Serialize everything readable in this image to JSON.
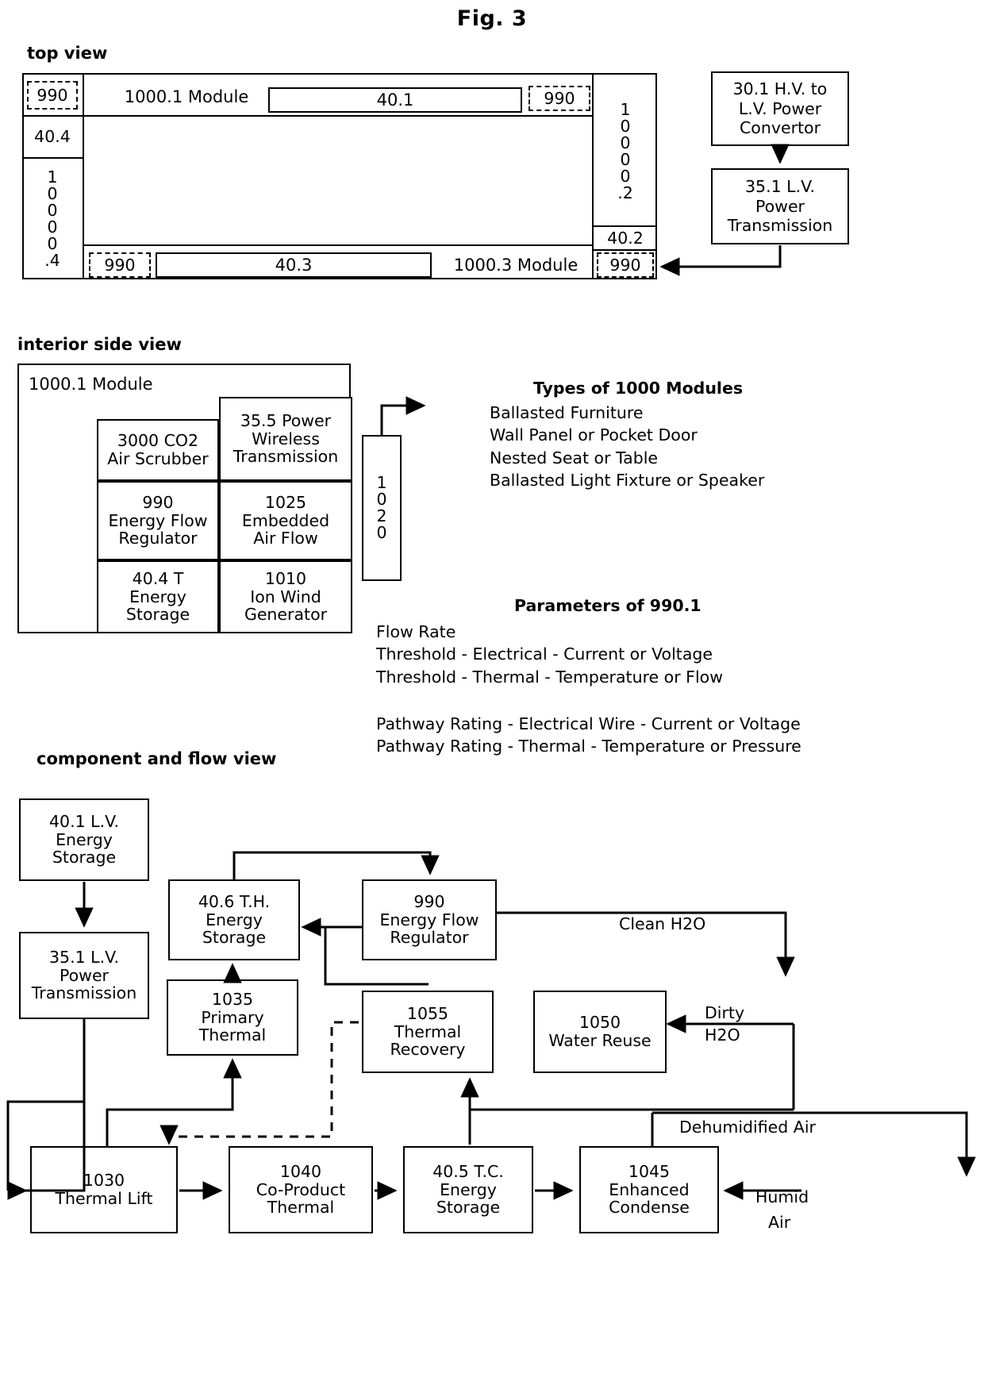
{
  "figure": {
    "title": "Fig. 3"
  },
  "views": {
    "top": {
      "label": "top view",
      "left_column": {
        "regulator_top": "990",
        "storage": "40.4",
        "vertical_id_chars": [
          "1",
          "0",
          "0",
          "0",
          "0",
          ".4"
        ]
      },
      "row_top": {
        "module_label": "1000.1 Module",
        "bus": "40.1",
        "regulator_right": "990"
      },
      "right_column": {
        "vertical_id_chars": [
          "1",
          "0",
          "0",
          "0",
          "0",
          ".2"
        ],
        "storage": "40.2",
        "regulator_bottom": "990"
      },
      "row_bottom": {
        "regulator_left": "990",
        "bus": "40.3",
        "module_label": "1000.3 Module"
      },
      "power_chain": {
        "converter": "30.1 H.V. to L.V. Power Convertor",
        "converter_lines": [
          "30.1 H.V. to",
          "L.V. Power",
          "Convertor"
        ],
        "transmission": "35.1 L.V. Power Transmission",
        "transmission_lines": [
          "35.1 L.V.",
          "Power",
          "Transmission"
        ]
      }
    },
    "interior": {
      "label": "interior side view",
      "module_label": "1000.1 Module",
      "cells": [
        {
          "lines": [
            "3000 CO2",
            "Air Scrubber"
          ]
        },
        {
          "lines": [
            "35.5 Power",
            "Wireless",
            "Transmission"
          ]
        },
        {
          "lines": [
            "990",
            "Energy Flow",
            "Regulator"
          ]
        },
        {
          "lines": [
            "1025",
            "Embedded",
            "Air Flow"
          ]
        },
        {
          "lines": [
            "40.4 T",
            "Energy",
            "Storage"
          ]
        },
        {
          "lines": [
            "1010",
            "Ion Wind",
            "Generator"
          ]
        }
      ],
      "side_connector_chars": [
        "1",
        "0",
        "2",
        "0"
      ]
    },
    "flow": {
      "label": "component and flow view",
      "nodes": [
        {
          "id": "40_1",
          "lines": [
            "40.1 L.V.",
            "Energy",
            "Storage"
          ]
        },
        {
          "id": "35_1",
          "lines": [
            "35.1 L.V.",
            "Power",
            "Transmission"
          ]
        },
        {
          "id": "40_6",
          "lines": [
            "40.6 T.H.",
            "Energy",
            "Storage"
          ]
        },
        {
          "id": "990",
          "lines": [
            "990",
            "Energy Flow",
            "Regulator"
          ]
        },
        {
          "id": "1035",
          "lines": [
            "1035",
            "Primary",
            "Thermal"
          ]
        },
        {
          "id": "1055",
          "lines": [
            "1055",
            "Thermal",
            "Recovery"
          ]
        },
        {
          "id": "1050",
          "lines": [
            "1050",
            "Water Reuse"
          ]
        },
        {
          "id": "1030",
          "lines": [
            "1030",
            "Thermal Lift"
          ]
        },
        {
          "id": "1040",
          "lines": [
            "1040",
            "Co-Product",
            "Thermal"
          ]
        },
        {
          "id": "40_5",
          "lines": [
            "40.5 T.C.",
            "Energy",
            "Storage"
          ]
        },
        {
          "id": "1045",
          "lines": [
            "1045",
            "Enhanced",
            "Condense"
          ]
        }
      ],
      "flow_labels": {
        "clean_water": "Clean H2O",
        "dirty_water_l1": "Dirty",
        "dirty_water_l2": "H2O",
        "dehumidified_air": "Dehumidified Air",
        "humid_air_l1": "Humid",
        "humid_air_l2": "Air"
      }
    }
  },
  "annotations": {
    "module_types": {
      "heading": "Types of 1000 Modules",
      "items": [
        "Ballasted Furniture",
        "Wall Panel or Pocket Door",
        "Nested Seat or Table",
        "Ballasted Light Fixture or Speaker"
      ]
    },
    "parameters": {
      "heading": "Parameters of 990.1",
      "group_one": [
        "Flow Rate",
        "Threshold - Electrical - Current or  Voltage",
        "Threshold - Thermal - Temperature or Flow"
      ],
      "group_two": [
        "Pathway Rating - Electrical Wire - Current or Voltage",
        "Pathway Rating - Thermal - Temperature or Pressure"
      ]
    }
  },
  "colors": {
    "ink": "#000000",
    "paper": "#ffffff"
  }
}
